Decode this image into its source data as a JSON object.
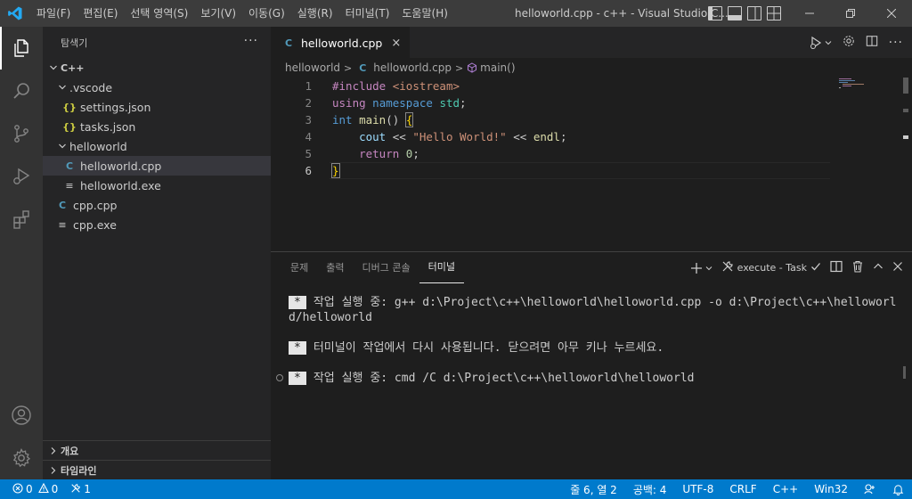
{
  "titlebar": {
    "menu": [
      "파일(F)",
      "편집(E)",
      "선택 영역(S)",
      "보기(V)",
      "이동(G)",
      "실행(R)",
      "터미널(T)",
      "도움말(H)"
    ],
    "window_title": "helloworld.cpp - c++ - Visual Studio C..."
  },
  "sidebar": {
    "title": "탐색기",
    "tree": [
      {
        "label": "C++",
        "depth": 0,
        "kind": "root-folder",
        "expanded": true
      },
      {
        "label": ".vscode",
        "depth": 1,
        "kind": "folder",
        "expanded": true
      },
      {
        "label": "settings.json",
        "depth": 2,
        "kind": "json"
      },
      {
        "label": "tasks.json",
        "depth": 2,
        "kind": "json"
      },
      {
        "label": "helloworld",
        "depth": 1,
        "kind": "folder",
        "expanded": true
      },
      {
        "label": "helloworld.cpp",
        "depth": 2,
        "kind": "cpp",
        "selected": true
      },
      {
        "label": "helloworld.exe",
        "depth": 2,
        "kind": "exe"
      },
      {
        "label": "cpp.cpp",
        "depth": 1,
        "kind": "cpp"
      },
      {
        "label": "cpp.exe",
        "depth": 1,
        "kind": "exe"
      }
    ],
    "sections": [
      "개요",
      "타임라인"
    ]
  },
  "editor": {
    "tab": {
      "label": "helloworld.cpp",
      "close": "×"
    },
    "breadcrumb": {
      "folder": "helloworld",
      "file": "helloworld.cpp",
      "symbol": "main()"
    },
    "lines": [
      "1",
      "2",
      "3",
      "4",
      "5",
      "6"
    ],
    "code": {
      "l1_dir": "#include",
      "l1_inc": "<iostream>",
      "l2_using": "using",
      "l2_namespace": "namespace",
      "l2_std": "std",
      "l2_semi": ";",
      "l3_int": "int",
      "l3_main": "main",
      "l3_paren": "()",
      "l3_brace": "{",
      "l4_cout": "cout",
      "l4_op1": "<<",
      "l4_str": "\"Hello World!\"",
      "l4_op2": "<<",
      "l4_endl": "endl",
      "l4_semi": ";",
      "l5_return": "return",
      "l5_num": "0",
      "l5_semi": ";",
      "l6_brace": "}"
    }
  },
  "panel": {
    "tabs": [
      "문제",
      "출력",
      "디버그 콘솔",
      "터미널"
    ],
    "active_tab": "터미널",
    "task_label": "execute - Task",
    "terminal": [
      {
        "badge": "*",
        "text": "작업 실행 중: g++ d:\\Project\\c++\\helloworld\\helloworld.cpp -o d:\\Project\\c++\\helloworld/helloworld"
      },
      {
        "badge": "*",
        "text": "터미널이 작업에서 다시 사용됩니다. 닫으려면 아무 키나 누르세요."
      },
      {
        "badge": "*",
        "text": "작업 실행 중: cmd /C d:\\Project\\c++\\helloworld\\helloworld"
      }
    ]
  },
  "statusbar": {
    "errors": "0",
    "warnings": "0",
    "tasks": "1",
    "position": "줄 6, 열 2",
    "indent": "공백: 4",
    "encoding": "UTF-8",
    "eol": "CRLF",
    "language": "C++",
    "platform": "Win32"
  },
  "colors": {
    "accent": "#007acc",
    "titlebar": "#3c3c3c",
    "activitybar": "#333333",
    "sidebar": "#252526",
    "editor": "#1e1e1e"
  }
}
